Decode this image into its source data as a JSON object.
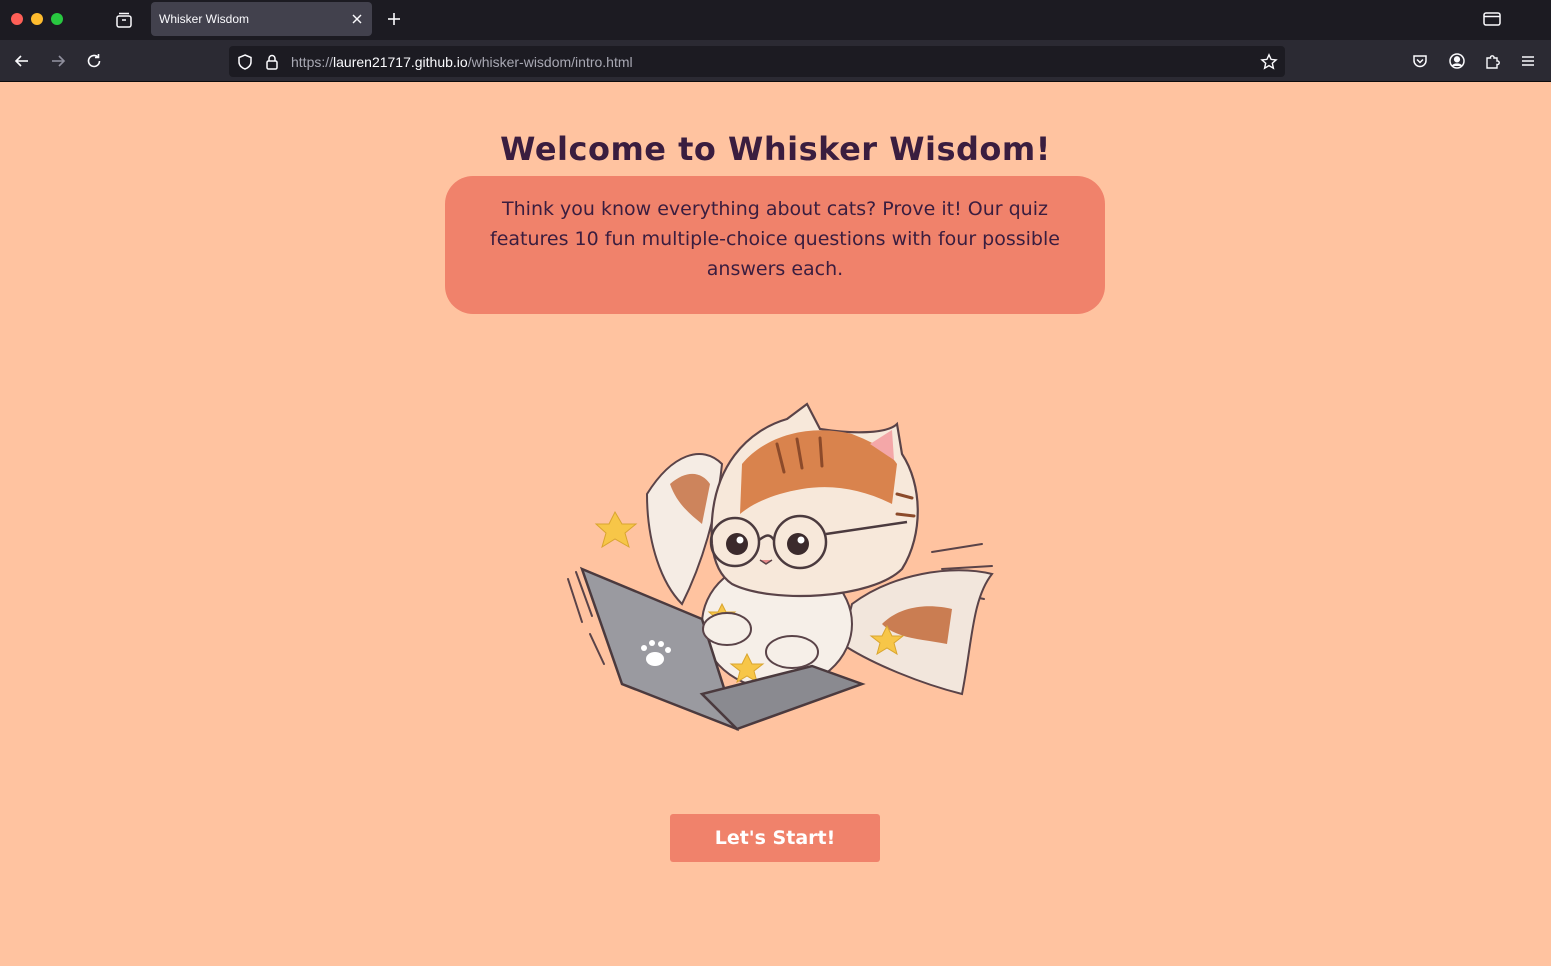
{
  "browser": {
    "tab": {
      "title": "Whisker Wisdom"
    },
    "url": {
      "scheme": "https://",
      "host": "lauren21717.github.io",
      "path": "/whisker-wisdom/intro.html"
    }
  },
  "page": {
    "heading": "Welcome to Whisker Wisdom!",
    "intro_text": "Think you know everything about cats? Prove it! Our quiz features 10 fun multiple-choice questions with four possible answers each.",
    "start_button": "Let's Start!",
    "colors": {
      "background": "#ffc3a0",
      "accent": "#f0826b",
      "text": "#3a1d3f"
    },
    "illustration": "cat-with-glasses-typing-on-laptop"
  },
  "icons": {
    "tabs_overview": "tabs-overview-icon",
    "close_tab": "close-icon",
    "new_tab": "plus-icon",
    "back": "back-arrow-icon",
    "forward": "forward-arrow-icon",
    "reload": "reload-icon",
    "shield": "shield-icon",
    "lock": "lock-icon",
    "bookmark": "star-icon",
    "pocket": "pocket-icon",
    "account": "account-icon",
    "extensions": "puzzle-icon",
    "menu": "hamburger-menu-icon"
  }
}
